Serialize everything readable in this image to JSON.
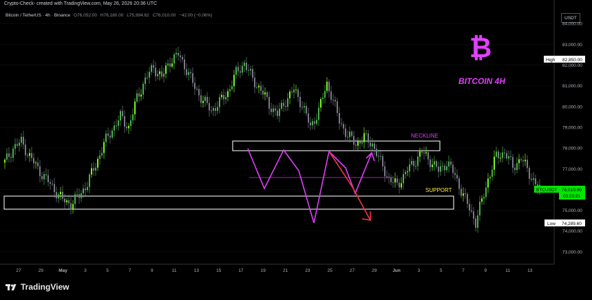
{
  "header": {
    "attribution": "Crypto-Check- created with TradingView.com, May 26, 2026 20:36 UTC",
    "symbol": "Bitcoin / TetherUS · 4h · Binance",
    "open_label": "O",
    "open_value": "76,052.00",
    "high_label": "H",
    "high_value": "76,180.00",
    "low_label": "L",
    "low_value": "75,994.62",
    "close_label": "C",
    "close_value": "76,010.00",
    "change": "−42.00 (−0.06%)",
    "currency": "USDT"
  },
  "annotations": {
    "title": "BITCOIN 4H",
    "neckline": "NECKLINE",
    "support": "SUPPORT",
    "bitcoin_logo": "₿"
  },
  "price_tags": {
    "high_label": "High",
    "high_value": "82,850.00",
    "ticker_label": "BTCUSDT",
    "current_value": "76,010.00",
    "countdown": "03:23:21",
    "low_label": "Low",
    "low_value": "74,289.60"
  },
  "footer": {
    "brand": "TradingView"
  },
  "colors": {
    "up": "#4caf50",
    "up_bright": "#7bfa1e",
    "down": "#787b86",
    "magenta": "#e040fb",
    "accent_yellow": "#ffeb3b",
    "arrow_red": "#f23645",
    "green_tag": "#00e600"
  },
  "chart_data": {
    "type": "candlestick",
    "y_ticks": [
      "84,000.00",
      "83,000.00",
      "82,000.00",
      "81,000.00",
      "80,000.00",
      "79,000.00",
      "78,000.00",
      "77,000.00",
      "76,000.00",
      "75,000.00",
      "74,000.00",
      "73,000.00"
    ],
    "x_ticks": [
      "27",
      "29",
      "May",
      "3",
      "5",
      "7",
      "9",
      "11",
      "13",
      "15",
      "17",
      "19",
      "21",
      "23",
      "25",
      "27",
      "29",
      "Jun",
      "3",
      "5",
      "7",
      "9",
      "11",
      "13"
    ],
    "ylim": [
      72400,
      84800
    ],
    "close_path": [
      [
        0,
        77300
      ],
      [
        4,
        78000
      ],
      [
        8,
        78300
      ],
      [
        12,
        77600
      ],
      [
        16,
        77000
      ],
      [
        20,
        76500
      ],
      [
        24,
        76000
      ],
      [
        28,
        75500
      ],
      [
        32,
        75300
      ],
      [
        36,
        75700
      ],
      [
        40,
        76300
      ],
      [
        44,
        77200
      ],
      [
        48,
        78200
      ],
      [
        52,
        78900
      ],
      [
        56,
        79500
      ],
      [
        60,
        79000
      ],
      [
        64,
        80400
      ],
      [
        68,
        81300
      ],
      [
        72,
        81900
      ],
      [
        76,
        81400
      ],
      [
        80,
        82200
      ],
      [
        84,
        82500
      ],
      [
        88,
        81800
      ],
      [
        92,
        80900
      ],
      [
        96,
        80300
      ],
      [
        100,
        79800
      ],
      [
        104,
        80200
      ],
      [
        108,
        80700
      ],
      [
        112,
        81600
      ],
      [
        116,
        82100
      ],
      [
        120,
        81300
      ],
      [
        124,
        80800
      ],
      [
        128,
        80100
      ],
      [
        132,
        79600
      ],
      [
        136,
        80300
      ],
      [
        140,
        80800
      ],
      [
        144,
        80100
      ],
      [
        148,
        79000
      ],
      [
        152,
        79800
      ],
      [
        156,
        81100
      ],
      [
        158,
        80600
      ],
      [
        162,
        79300
      ],
      [
        166,
        78600
      ],
      [
        170,
        78200
      ],
      [
        174,
        78500
      ],
      [
        178,
        78200
      ],
      [
        182,
        77300
      ],
      [
        186,
        76500
      ],
      [
        190,
        76200
      ],
      [
        194,
        76800
      ],
      [
        198,
        77300
      ],
      [
        202,
        77800
      ],
      [
        206,
        77400
      ],
      [
        210,
        76900
      ],
      [
        214,
        77300
      ],
      [
        218,
        76700
      ],
      [
        222,
        75700
      ],
      [
        226,
        74900
      ],
      [
        228,
        74400
      ],
      [
        230,
        75100
      ],
      [
        234,
        76500
      ],
      [
        238,
        77600
      ],
      [
        242,
        77800
      ],
      [
        246,
        77100
      ],
      [
        250,
        77500
      ],
      [
        254,
        76800
      ],
      [
        258,
        76050
      ],
      [
        259.5,
        76010
      ]
    ],
    "high": 82850.0,
    "low": 74289.6,
    "last": 76010.0
  }
}
